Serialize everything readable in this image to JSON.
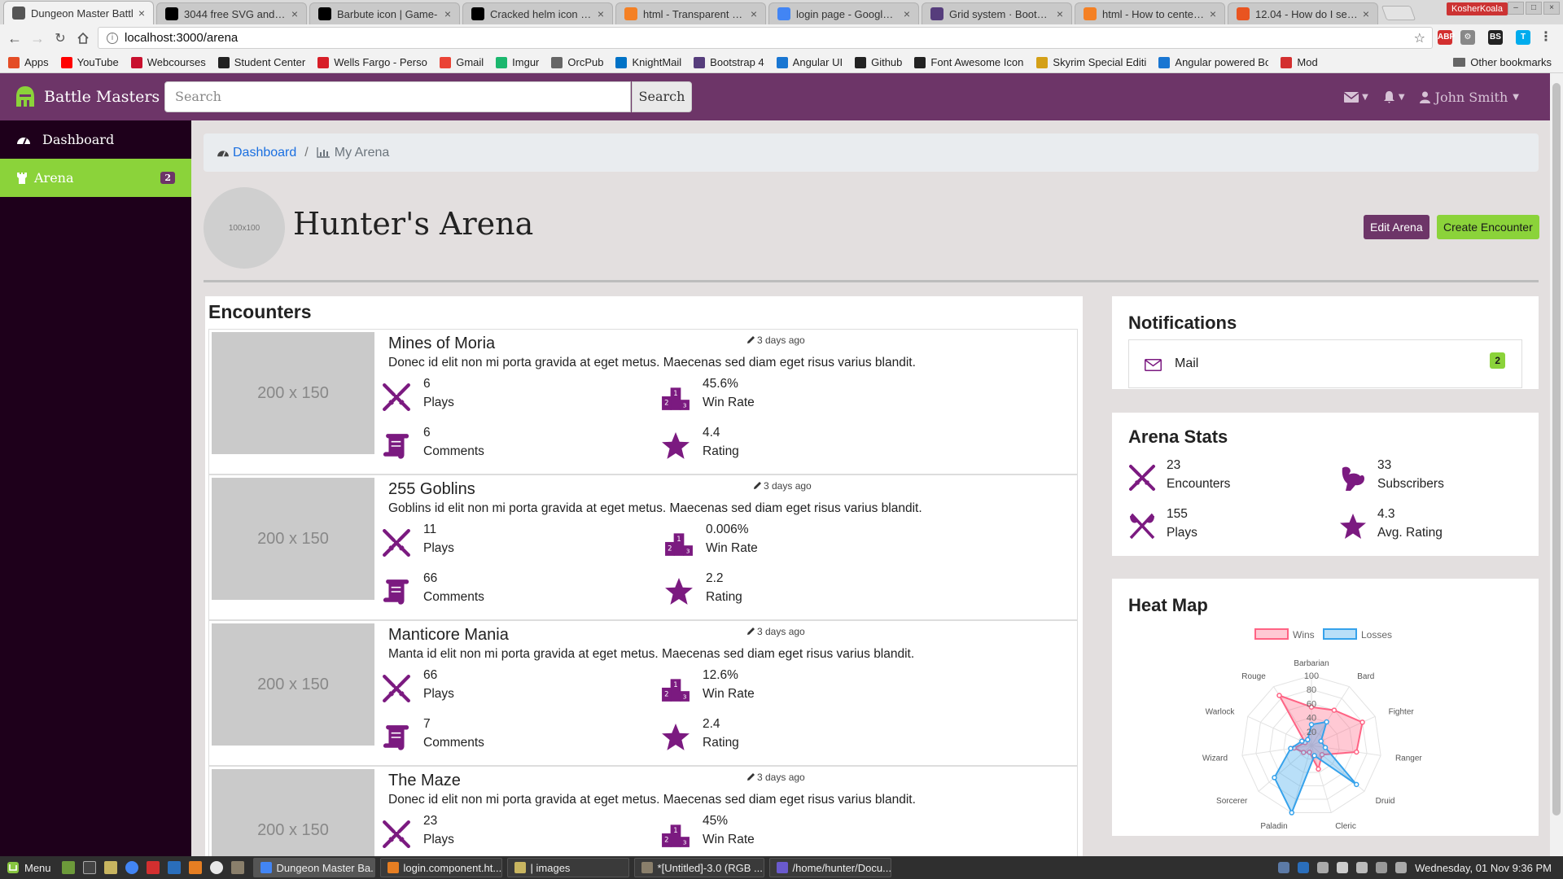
{
  "browser": {
    "tabs": [
      {
        "label": "Dungeon Master Battl",
        "active": true,
        "icon_color": "#555555"
      },
      {
        "label": "3044 free SVG and PN",
        "active": false,
        "icon_color": "#000000"
      },
      {
        "label": "Barbute icon | Game-",
        "active": false,
        "icon_color": "#000000"
      },
      {
        "label": "Cracked helm icon | G",
        "active": false,
        "icon_color": "#000000"
      },
      {
        "label": "html - Transparent CS",
        "active": false,
        "icon_color": "#f48024"
      },
      {
        "label": "login page - Google Se",
        "active": false,
        "icon_color": "#4285f4"
      },
      {
        "label": "Grid system · Bootstra",
        "active": false,
        "icon_color": "#563d7c"
      },
      {
        "label": "html - How to center a",
        "active": false,
        "icon_color": "#f48024"
      },
      {
        "label": "12.04 - How do I set a",
        "active": false,
        "icon_color": "#e95420"
      }
    ],
    "tab_close": "×",
    "profile_name": "KosherKoala",
    "url": "localhost:3000/arena",
    "bookmarks": [
      {
        "label": "Apps",
        "color": "#e44d26"
      },
      {
        "label": "YouTube",
        "color": "#ff0000"
      },
      {
        "label": "Webcourses",
        "color": "#c8102e"
      },
      {
        "label": "Student Center",
        "color": "#222222"
      },
      {
        "label": "Wells Fargo - Person",
        "color": "#d71e28"
      },
      {
        "label": "Gmail",
        "color": "#ea4335"
      },
      {
        "label": "Imgur",
        "color": "#1bb76e"
      },
      {
        "label": "OrcPub",
        "color": "#666666"
      },
      {
        "label": "KnightMail",
        "color": "#0072c6"
      },
      {
        "label": "Bootstrap 4",
        "color": "#563d7c"
      },
      {
        "label": "Angular UI",
        "color": "#1976d2"
      },
      {
        "label": "Github",
        "color": "#222222"
      },
      {
        "label": "Font Awesome Icons",
        "color": "#222222"
      },
      {
        "label": "Skyrim Special Editic",
        "color": "#d4a017"
      },
      {
        "label": "Angular powered Bo",
        "color": "#1976d2"
      },
      {
        "label": "Mod",
        "color": "#d32f2f"
      }
    ],
    "other_bookmarks": "Other bookmarks"
  },
  "app": {
    "brand": "Battle Masters",
    "search_placeholder": "Search",
    "search_button": "Search",
    "user_name": "John Smith",
    "colors": {
      "primary": "#6d3568",
      "accent": "#8bd33a",
      "sidebar": "#1e001b",
      "icon": "#7b1a80"
    }
  },
  "sidebar": {
    "items": [
      {
        "label": "Dashboard",
        "active": false
      },
      {
        "label": "Arena",
        "active": true,
        "badge": "2"
      }
    ]
  },
  "breadcrumb": {
    "home": "Dashboard",
    "sep": "/",
    "current": "My Arena"
  },
  "arena": {
    "avatar_text": "100x100",
    "title": "Hunter's Arena",
    "edit_button": "Edit Arena",
    "create_button": "Create Encounter"
  },
  "encounters": {
    "title": "Encounters",
    "image_text": "200 x 150",
    "labels": {
      "plays": "Plays",
      "win_rate": "Win Rate",
      "comments": "Comments",
      "rating": "Rating"
    },
    "items": [
      {
        "name": "Mines of Moria",
        "time": "3 days ago",
        "desc": "Donec id elit non mi porta gravida at eget metus. Maecenas sed diam eget risus varius blandit.",
        "plays": "6",
        "win_rate": "45.6%",
        "comments": "6",
        "rating": "4.4"
      },
      {
        "name": "255 Goblins",
        "time": "3 days ago",
        "desc": "Goblins id elit non mi porta gravida at eget metus. Maecenas sed diam eget risus varius blandit.",
        "plays": "11",
        "win_rate": "0.006%",
        "comments": "66",
        "rating": "2.2"
      },
      {
        "name": "Manticore Mania",
        "time": "3 days ago",
        "desc": "Manta id elit non mi porta gravida at eget metus. Maecenas sed diam eget risus varius blandit.",
        "plays": "66",
        "win_rate": "12.6%",
        "comments": "7",
        "rating": "2.4"
      },
      {
        "name": "The Maze",
        "time": "3 days ago",
        "desc": "Donec id elit non mi porta gravida at eget metus. Maecenas sed diam eget risus varius blandit.",
        "plays": "23",
        "win_rate": "45%",
        "comments": "",
        "rating": ""
      }
    ]
  },
  "notifications": {
    "title": "Notifications",
    "mail_label": "Mail",
    "mail_count": "2"
  },
  "arena_stats": {
    "title": "Arena Stats",
    "encounters_value": "23",
    "encounters_label": "Encounters",
    "subscribers_value": "33",
    "subscribers_label": "Subscribers",
    "plays_value": "155",
    "plays_label": "Plays",
    "rating_value": "4.3",
    "rating_label": "Avg. Rating"
  },
  "heat_map": {
    "title": "Heat Map",
    "chart_data": {
      "type": "radar",
      "categories": [
        "Barbarian",
        "Bard",
        "Fighter",
        "Ranger",
        "Druid",
        "Cleric",
        "Paladin",
        "Sorcerer",
        "Wizard",
        "Warlock",
        "Rouge"
      ],
      "rlim": [
        0,
        100
      ],
      "ticks": [
        "20",
        "40",
        "60",
        "80",
        "100"
      ],
      "legend_position": "top",
      "series": [
        {
          "name": "Wins",
          "color": "#ff6384",
          "values": [
            55,
            60,
            80,
            65,
            20,
            35,
            10,
            15,
            25,
            10,
            85
          ]
        },
        {
          "name": "Losses",
          "color": "#36a2eb",
          "values": [
            30,
            40,
            15,
            20,
            85,
            15,
            100,
            70,
            30,
            15,
            10
          ]
        }
      ]
    }
  },
  "taskbar": {
    "menu_label": "Menu",
    "windows": [
      {
        "label": "Dungeon Master Ba...",
        "active": true,
        "color": "#4285f4"
      },
      {
        "label": "login.component.ht...",
        "active": false,
        "color": "#e67e22"
      },
      {
        "label": "| images",
        "active": false,
        "color": "#c8b560"
      },
      {
        "label": "*[Untitled]-3.0 (RGB ...",
        "active": false,
        "color": "#8a7f6b"
      },
      {
        "label": "/home/hunter/Docu...",
        "active": false,
        "color": "#6a5acd"
      }
    ],
    "clock": "Wednesday, 01 Nov  9:36 PM"
  }
}
